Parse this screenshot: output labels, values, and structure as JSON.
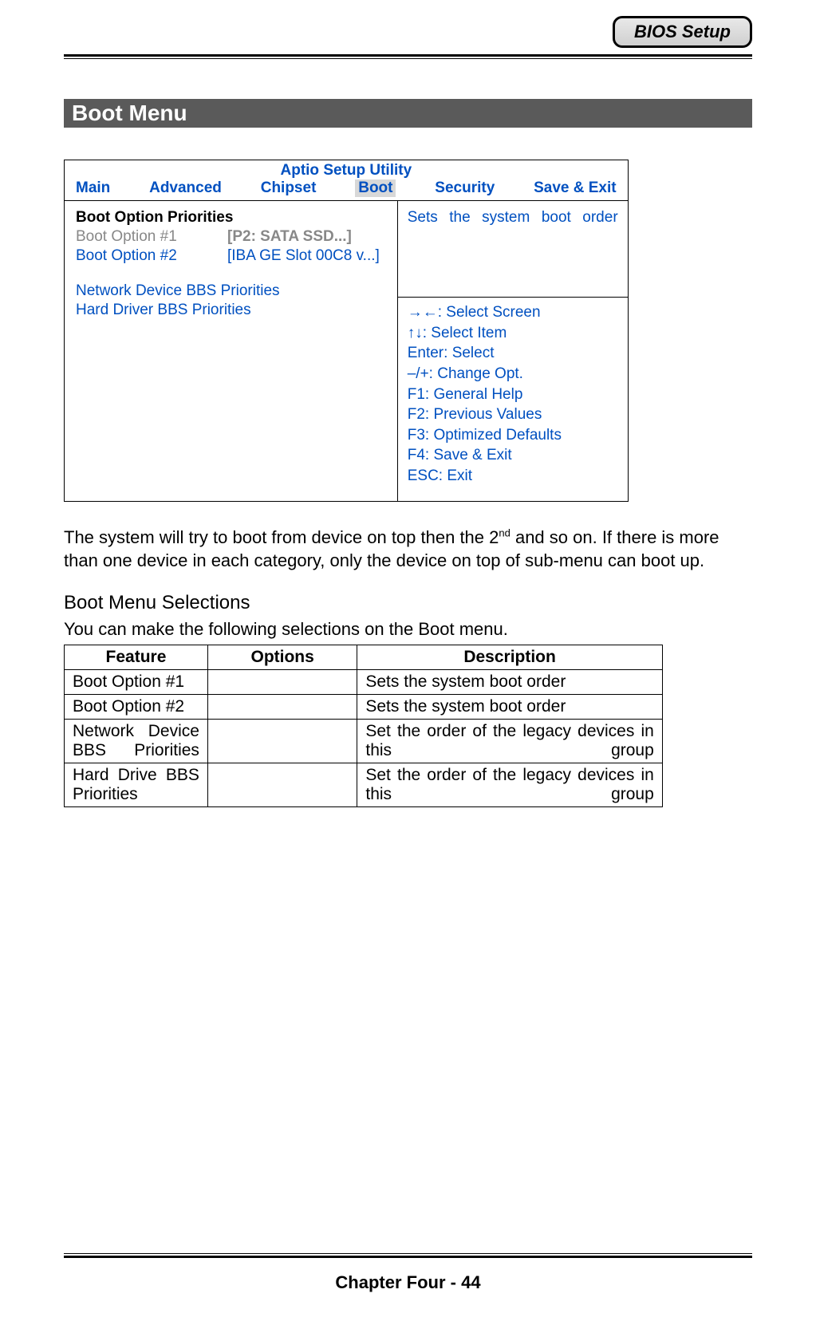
{
  "header": {
    "badge": "BIOS Setup"
  },
  "section_title": "Boot Menu",
  "bios": {
    "title": "Aptio Setup Utility",
    "tabs": [
      "Main",
      "Advanced",
      "Chipset",
      "Boot",
      "Security",
      "Save & Exit"
    ],
    "active_tab": "Boot",
    "left": {
      "heading": "Boot Option Priorities",
      "option1_label": "Boot Option #1",
      "option1_value": "[P2: SATA SSD...]",
      "option2_label": "Boot Option #2",
      "option2_value": "[IBA GE Slot 00C8 v...]",
      "item1": "Network Device BBS Priorities",
      "item2": "Hard Driver BBS Priorities"
    },
    "help": "Sets the system boot order",
    "keys": [
      "→←: Select Screen",
      "↑↓: Select Item",
      "Enter: Select",
      "–/+: Change Opt.",
      "F1: General Help",
      "F2: Previous Values",
      "F3: Optimized Defaults",
      "F4: Save & Exit",
      "ESC: Exit"
    ]
  },
  "desc_para_before": "The system will try to boot from device on top then the 2",
  "desc_para_sup": "nd",
  "desc_para_after": " and so on. If there is more than one device in each category, only the device on top of sub-menu can boot up.",
  "sub_heading": "Boot Menu Selections",
  "sub_text": "You can make the following selections on the Boot menu.",
  "sel_headers": [
    "Feature",
    "Options",
    "Description"
  ],
  "sel_rows": [
    {
      "feature": "Boot Option #1",
      "options": "",
      "description": "Sets the system boot order",
      "justify": false
    },
    {
      "feature": "Boot Option #2",
      "options": "",
      "description": "Sets the system boot order",
      "justify": false
    },
    {
      "feature": "Network Device BBS Priorities",
      "options": "",
      "description": "Set the order of the legacy devices in this group",
      "justify": true
    },
    {
      "feature": "Hard Drive BBS Priorities",
      "options": "",
      "description": "Set the order of the legacy devices in this group",
      "justify": true
    }
  ],
  "footer": "Chapter Four - 44"
}
